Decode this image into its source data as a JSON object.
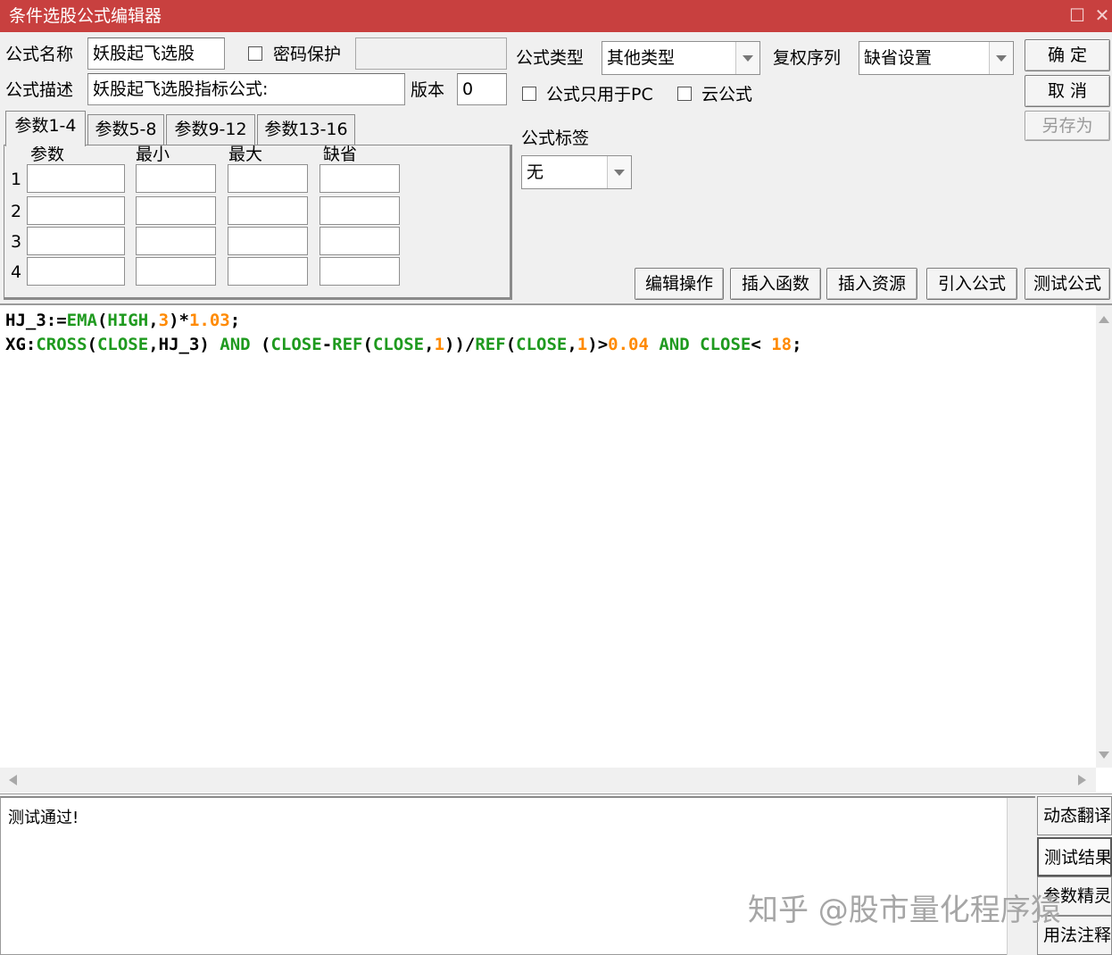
{
  "window": {
    "title": "条件选股公式编辑器"
  },
  "form": {
    "name_label": "公式名称",
    "name_value": "妖股起飞选股",
    "password_label": "密码保护",
    "desc_label": "公式描述",
    "desc_value": "妖股起飞选股指标公式:",
    "version_label": "版本",
    "version_value": "0",
    "type_label": "公式类型",
    "type_value": "其他类型",
    "fq_label": "复权序列",
    "fq_value": "缺省设置",
    "pc_only_label": "公式只用于PC",
    "cloud_label": "云公式",
    "tag_label": "公式标签",
    "tag_value": "无"
  },
  "buttons": {
    "ok": "确  定",
    "cancel": "取  消",
    "save_as": "另存为",
    "edit_ops": "编辑操作",
    "insert_func": "插入函数",
    "insert_res": "插入资源",
    "import_formula": "引入公式",
    "test_formula": "测试公式"
  },
  "param_tabs": [
    "参数1-4",
    "参数5-8",
    "参数9-12",
    "参数13-16"
  ],
  "param_table": {
    "headers": [
      "参数",
      "最小",
      "最大",
      "缺省"
    ],
    "rows": [
      "1",
      "2",
      "3",
      "4"
    ]
  },
  "code": {
    "line1": [
      {
        "t": "HJ_3:=",
        "c": "id"
      },
      {
        "t": "EMA",
        "c": "fn"
      },
      {
        "t": "(",
        "c": "id"
      },
      {
        "t": "HIGH",
        "c": "fn"
      },
      {
        "t": ",",
        "c": "id"
      },
      {
        "t": "3",
        "c": "num"
      },
      {
        "t": ")*",
        "c": "id"
      },
      {
        "t": "1.03",
        "c": "num"
      },
      {
        "t": ";",
        "c": "id"
      }
    ],
    "line2": [
      {
        "t": "XG:",
        "c": "id"
      },
      {
        "t": "CROSS",
        "c": "fn"
      },
      {
        "t": "(",
        "c": "id"
      },
      {
        "t": "CLOSE",
        "c": "fn"
      },
      {
        "t": ",HJ_3) ",
        "c": "id"
      },
      {
        "t": "AND",
        "c": "fn"
      },
      {
        "t": " (",
        "c": "id"
      },
      {
        "t": "CLOSE",
        "c": "fn"
      },
      {
        "t": "-",
        "c": "id"
      },
      {
        "t": "REF",
        "c": "fn"
      },
      {
        "t": "(",
        "c": "id"
      },
      {
        "t": "CLOSE",
        "c": "fn"
      },
      {
        "t": ",",
        "c": "id"
      },
      {
        "t": "1",
        "c": "num"
      },
      {
        "t": "))/",
        "c": "id"
      },
      {
        "t": "REF",
        "c": "fn"
      },
      {
        "t": "(",
        "c": "id"
      },
      {
        "t": "CLOSE",
        "c": "fn"
      },
      {
        "t": ",",
        "c": "id"
      },
      {
        "t": "1",
        "c": "num"
      },
      {
        "t": ")>",
        "c": "id"
      },
      {
        "t": "0.04",
        "c": "num"
      },
      {
        "t": " ",
        "c": "id"
      },
      {
        "t": "AND",
        "c": "fn"
      },
      {
        "t": " ",
        "c": "id"
      },
      {
        "t": "CLOSE",
        "c": "fn"
      },
      {
        "t": "< ",
        "c": "id"
      },
      {
        "t": "18",
        "c": "num"
      },
      {
        "t": ";",
        "c": "id"
      }
    ]
  },
  "output": {
    "text": "测试通过!"
  },
  "side_buttons": [
    "动态翻译",
    "测试结果",
    "参数精灵",
    "用法注释"
  ],
  "watermark": "知乎 @股市量化程序猿",
  "colors": {
    "titlebar": "#c8403f",
    "function": "#1f9a1f",
    "number": "#ff8a00"
  }
}
